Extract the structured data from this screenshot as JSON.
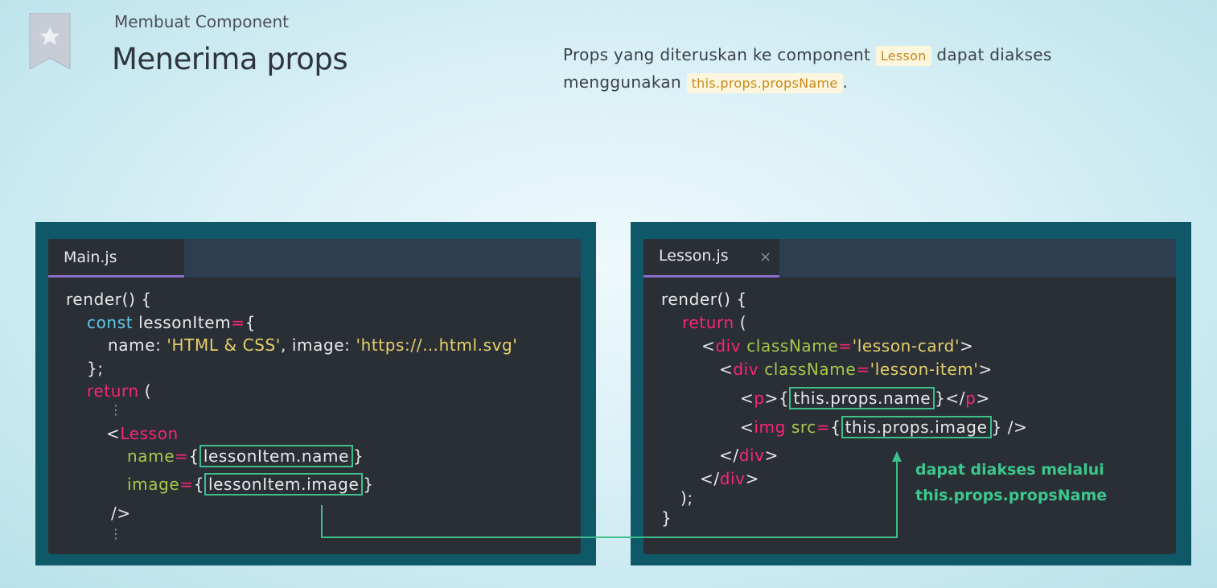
{
  "header": {
    "subtitle": "Membuat Component",
    "title": "Menerima props"
  },
  "description": {
    "part1": "Props yang diteruskan ke component ",
    "code1": "Lesson",
    "part2": " dapat diakses menggunakan ",
    "code2": "this.props.propsName",
    "part3": "."
  },
  "left_editor": {
    "tab": "Main.js",
    "lines": {
      "l1": "render() {",
      "l2_kw": "const",
      "l2_rest": " lessonItem",
      "l2_eq": "=",
      "l2_brace": "{",
      "l3_key": "name: ",
      "l3_val": "'HTML & CSS'",
      "l3_mid": ", image: ",
      "l3_val2": "'https://…html.svg'",
      "l4": "};",
      "l5_kw": "return",
      "l5_rest": " (",
      "l6": "⋮",
      "l7_lt": "<",
      "l7_tag": "Lesson",
      "l8_attr": "name",
      "l8_eq": "=",
      "l8_open": "{",
      "l8_val": "lessonItem.name",
      "l8_close": "}",
      "l9_attr": "image",
      "l9_eq": "=",
      "l9_open": "{",
      "l9_val": "lessonItem.image",
      "l9_close": "}",
      "l10": "/>",
      "l11": "⋮"
    }
  },
  "right_editor": {
    "tab": "Lesson.js",
    "close": "×",
    "lines": {
      "l1": "render() {",
      "l2_kw": "return",
      "l2_rest": " (",
      "l3_lt": "<",
      "l3_tag": "div",
      "l3_attr": " className",
      "l3_eq": "=",
      "l3_str": "'lesson-card'",
      "l3_gt": ">",
      "l4_lt": "<",
      "l4_tag": "div",
      "l4_attr": " className",
      "l4_eq": "=",
      "l4_str": "'lesson-item'",
      "l4_gt": ">",
      "l5_lt": "<",
      "l5_tag": "p",
      "l5_gt": ">{",
      "l5_val": "this.props.name",
      "l5_close": "}</",
      "l5_tag2": "p",
      "l5_end": ">",
      "l6_lt": "<",
      "l6_tag": "img",
      "l6_attr": " src",
      "l6_eq": "=",
      "l6_open": "{",
      "l6_val": "this.props.image",
      "l6_close": "} />",
      "l7_lt": "</",
      "l7_tag": "div",
      "l7_gt": ">",
      "l8_lt": "</",
      "l8_tag": "div",
      "l8_gt": ">",
      "l9": ");",
      "l10": "}"
    }
  },
  "annotation": {
    "line1": "dapat diakses melalui",
    "line2": "this.props.propsName"
  },
  "colors": {
    "accent_green": "#3dc08c",
    "panel_bg": "#0e5868",
    "keyword": "#f92672",
    "attribute": "#a6c94a",
    "string": "#e6d06a"
  }
}
